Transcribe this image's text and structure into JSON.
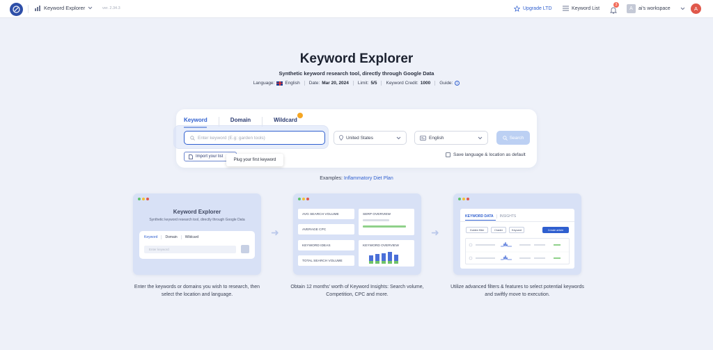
{
  "topbar": {
    "app_name": "Keyword Explorer",
    "version": "ver. 2.34.3",
    "upgrade_label": "Upgrade LTD",
    "keyword_list_label": "Keyword List",
    "notification_count": "3",
    "workspace_initial": "A",
    "workspace_label": "ai's workspace",
    "user_initial": "A"
  },
  "hero": {
    "title": "Keyword Explorer",
    "subtitle": "Synthetic keyword research tool, directly through Google Data",
    "language_label": "Language:",
    "language_value": "English",
    "date_label": "Date:",
    "date_value": "Mar 20, 2024",
    "limit_label": "Limit:",
    "limit_value": "5/5",
    "credit_label": "Keyword Credit:",
    "credit_value": "1000",
    "guide_label": "Guide:"
  },
  "search": {
    "tabs": [
      "Keyword",
      "Domain",
      "Wildcard"
    ],
    "active_tab": "Keyword",
    "input_placeholder": "Enter keyword (E.g: garden tools)",
    "country": "United States",
    "language": "English",
    "search_label": "Search",
    "import_label": "Import your list",
    "tooltip": "Plug your first keyword",
    "save_default_label": "Save language & location as default",
    "save_default_checked": false
  },
  "examples": {
    "label": "Examples:",
    "link": "Inflammatory Diet Plan"
  },
  "features": {
    "panel1": {
      "title": "Keyword Explorer",
      "subtitle": "Synthetic keyword research tool, directly through Google Data",
      "tabs": [
        "Keyword",
        "Domain",
        "Wildcard"
      ],
      "placeholder": "Enter keyword",
      "description": "Enter the keywords or domains you wish to research, then select the location and language."
    },
    "panel2": {
      "boxes": [
        "AVG SEARCH VOLUME",
        "AVERAGE CPC",
        "KEYWORD IDEAS",
        "TOTAL SEARCH VOLUME"
      ],
      "serp_label": "SERP OVERVIEW",
      "kw_overview_label": "KEYWORD OVERVIEW",
      "description": "Obtain 12 months' worth of Keyword Insights: Search volume, Competition, CPC and more."
    },
    "panel3": {
      "tab_active": "KEYWORD DATA",
      "tab_other": "INSIGHTS",
      "chips": [
        "Golden filter",
        "Cluster",
        "Keycard",
        "Create article"
      ],
      "description": "Utilize advanced filters & features to select potential keywords and swiftly move to execution."
    }
  },
  "colors": {
    "accent": "#2f5fcf",
    "page_bg": "#eef1f9",
    "panel_bg": "#d8e1f6",
    "badge": "#f26d5b",
    "avatar": "#e0584b"
  }
}
